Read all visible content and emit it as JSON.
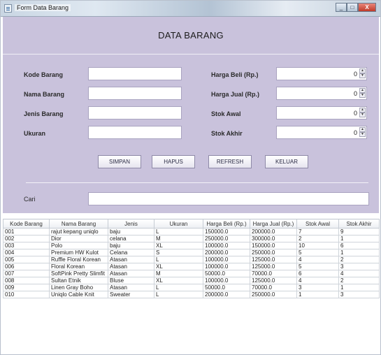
{
  "window": {
    "title": "Form Data Barang",
    "close_glyph": "X",
    "minimize_glyph": "_",
    "maximize_glyph": "□"
  },
  "form": {
    "heading": "DATA BARANG",
    "fields": {
      "kode_barang": {
        "label": "Kode Barang",
        "value": ""
      },
      "nama_barang": {
        "label": "Nama Barang",
        "value": ""
      },
      "jenis_barang": {
        "label": "Jenis Barang",
        "value": ""
      },
      "ukuran": {
        "label": "Ukuran",
        "value": ""
      },
      "harga_beli": {
        "label": "Harga Beli (Rp.)",
        "value": "0"
      },
      "harga_jual": {
        "label": "Harga Jual (Rp.)",
        "value": "0"
      },
      "stok_awal": {
        "label": "Stok Awal",
        "value": "0"
      },
      "stok_akhir": {
        "label": "Stok Akhir",
        "value": "0"
      }
    },
    "buttons": {
      "simpan": "SIMPAN",
      "hapus": "HAPUS",
      "refresh": "REFRESH",
      "keluar": "KELUAR"
    },
    "search": {
      "label": "Cari",
      "value": ""
    }
  },
  "table": {
    "columns": [
      "Kode Barang",
      "Nama Barang",
      "Jenis",
      "Ukuran",
      "Harga Beli (Rp.)",
      "Harga Jual (Rp.)",
      "Stok Awal",
      "Stok Akhir"
    ],
    "rows": [
      [
        "001",
        "rajut kepang uniqlo",
        "baju",
        "L",
        "150000.0",
        "200000.0",
        "7",
        "9"
      ],
      [
        "002",
        "Dior",
        "celana",
        "M",
        "250000.0",
        "300000.0",
        "2",
        "1"
      ],
      [
        "003",
        "Polo",
        "baju",
        "XL",
        "100000.0",
        "150000.0",
        "10",
        "6"
      ],
      [
        "004",
        "Premium HW Kulot",
        "Celana",
        "S",
        "200000.0",
        "250000.0",
        "5",
        "1"
      ],
      [
        "005",
        "Ruffle Floral Korean",
        "Atasan",
        "L",
        "100000.0",
        "125000.0",
        "4",
        "2"
      ],
      [
        "006",
        "Floral Korean",
        "Atasan",
        "XL",
        "100000.0",
        "125000.0",
        "5",
        "3"
      ],
      [
        "007",
        "SoftPink Pretty Slimfit",
        "Atasan",
        "M",
        "50000.0",
        "70000.0",
        "6",
        "4"
      ],
      [
        "008",
        "Sultan Etnik",
        "Bluse",
        "XL",
        "100000.0",
        "125000.0",
        "4",
        "2"
      ],
      [
        "009",
        "Linen Gray Boho",
        "Atasan",
        "L",
        "50000.0",
        "70000.0",
        "3",
        "1"
      ],
      [
        "010",
        "Uniqlo Cable Knit",
        "Sweater",
        "L",
        "200000.0",
        "250000.0",
        "1",
        "3"
      ]
    ]
  }
}
